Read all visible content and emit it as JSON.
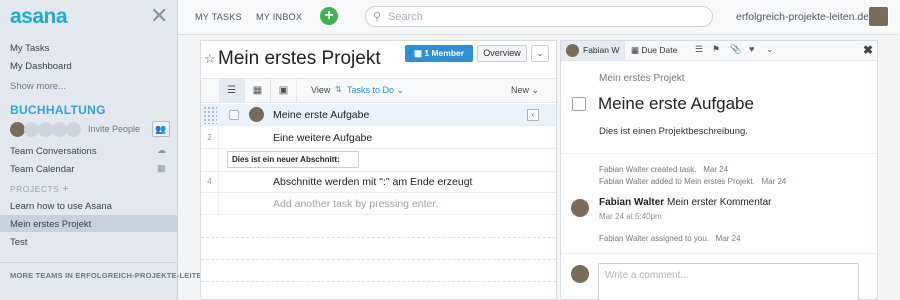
{
  "app": {
    "logo": "asana",
    "close_glyph": "✕"
  },
  "sidebar": {
    "top_items": [
      {
        "label": "My Tasks"
      },
      {
        "label": "My Dashboard"
      },
      {
        "label": "Show more..."
      }
    ],
    "team_name": "BUCHHALTUNG",
    "invite_label": "Invite People",
    "team_items": [
      {
        "label": "Team Conversations"
      },
      {
        "label": "Team Calendar"
      }
    ],
    "projects_label": "PROJECTS",
    "projects": [
      {
        "label": "Learn how to use Asana"
      },
      {
        "label": "Mein erstes Projekt",
        "active": true
      },
      {
        "label": "Test"
      }
    ],
    "footer": "MORE TEAMS IN ERFOLGREICH-PROJEKTE-LEITE..."
  },
  "topbar": {
    "my_tasks": "MY TASKS",
    "my_inbox": "MY INBOX",
    "search_placeholder": "Search",
    "workspace": "erfolgreich-projekte-leiten.de"
  },
  "project": {
    "title": "Mein erstes Projekt",
    "member_button": "1 Member",
    "overview_button": "Overview",
    "view_label": "View",
    "view_value": "Tasks to Do",
    "new_label": "New",
    "rows": [
      {
        "num": "",
        "text": "Meine erste Aufgabe"
      },
      {
        "num": "2",
        "text": "Eine weitere Aufgabe"
      },
      {
        "num": "",
        "text": "Dies ist ein neuer Abschnitt:"
      },
      {
        "num": "4",
        "text": "Abschnitte werden mit \":\" am Ende erzeugt"
      },
      {
        "num": "",
        "text": "Add another task by pressing enter."
      }
    ]
  },
  "task": {
    "assignee_tab": "Fabian W",
    "due_tab": "Due Date",
    "project_name": "Mein erstes Projekt",
    "title": "Meine erste Aufgabe",
    "description": "Dies ist einen Projektbeschreibung.",
    "activity": [
      {
        "text": "Fabian Walter created task.",
        "time": "Mar 24"
      },
      {
        "text": "Fabian Walter added to Mein erstes Projekt.",
        "time": "Mar 24"
      }
    ],
    "comment": {
      "author": "Fabian Walter",
      "text": "Mein erster Kommentar",
      "time": "Mar 24 at 5:40pm"
    },
    "assigned": {
      "text": "Fabian Walter assigned to you.",
      "time": "Mar 24"
    },
    "comment_placeholder": "Write a comment..."
  }
}
